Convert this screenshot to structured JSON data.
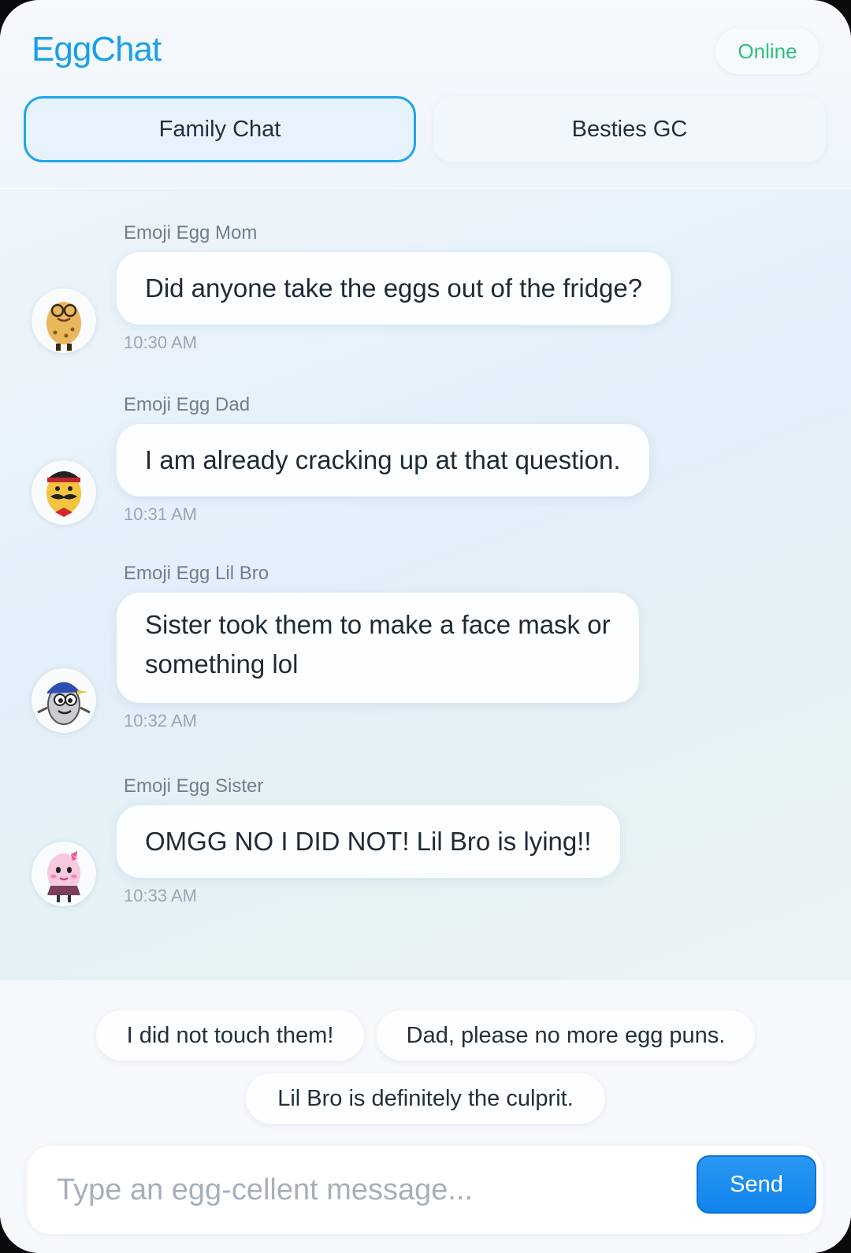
{
  "app": {
    "title": "EggChat",
    "status": "Online"
  },
  "tabs": [
    {
      "label": "Family Chat",
      "active": true
    },
    {
      "label": "Besties GC",
      "active": false
    }
  ],
  "messages": [
    {
      "sender": "Emoji Egg Mom",
      "text": "Did anyone take the eggs out of the fridge?",
      "time": "10:30 AM",
      "avatar": "egg-mom-avatar"
    },
    {
      "sender": "Emoji Egg Dad",
      "text": "I am already cracking up at that question.",
      "time": "10:31 AM",
      "avatar": "egg-dad-avatar"
    },
    {
      "sender": "Emoji Egg Lil Bro",
      "text_line1": "Sister took them to make a face mask or",
      "text_line2": "something lol",
      "time": "10:32 AM",
      "avatar": "egg-lil-bro-avatar"
    },
    {
      "sender": "Emoji Egg Sister",
      "text": "OMGG NO I DID NOT! Lil Bro is lying!!",
      "time": "10:33 AM",
      "avatar": "egg-sister-avatar"
    }
  ],
  "quick_replies": [
    "I did not touch them!",
    "Dad, please no more egg puns.",
    "Lil Bro is definitely the culprit."
  ],
  "composer": {
    "placeholder": "Type an egg-cellent message...",
    "send_label": "Send"
  },
  "colors": {
    "accent": "#1aa0e8",
    "online": "#2ec27e",
    "send_button": "#1183ec"
  }
}
